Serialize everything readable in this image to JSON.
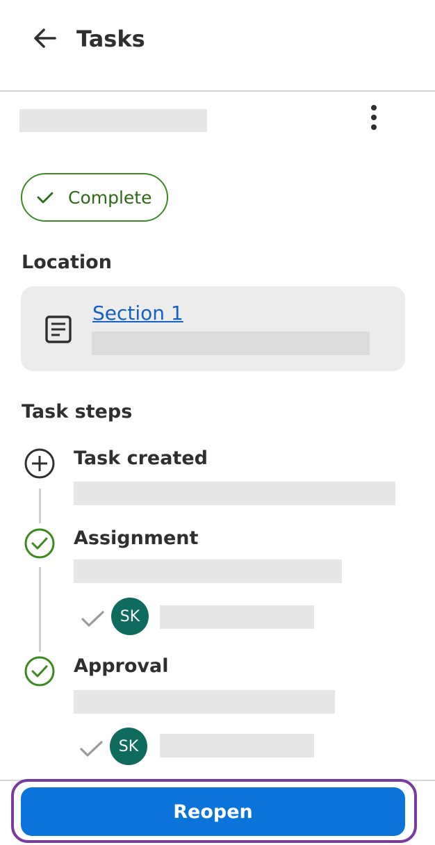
{
  "header": {
    "title": "Tasks",
    "back_icon": "arrow-left-icon"
  },
  "task": {
    "more_icon": "more-vertical-icon",
    "status": {
      "label": "Complete",
      "icon": "check-icon",
      "color": "#3b8a1f"
    }
  },
  "location": {
    "heading": "Location",
    "link_label": "Section 1",
    "icon": "document-icon"
  },
  "steps": {
    "heading": "Task steps",
    "items": [
      {
        "title": "Task created",
        "icon": "plus-circle-icon"
      },
      {
        "title": "Assignment",
        "icon": "check-circle-icon",
        "assignee_initials": "SK"
      },
      {
        "title": "Approval",
        "icon": "check-circle-icon",
        "assignee_initials": "SK"
      }
    ]
  },
  "footer": {
    "reopen_label": "Reopen"
  },
  "colors": {
    "primary": "#0a74da",
    "success": "#3b8a1f",
    "avatar": "#0f6b5e",
    "focus_ring": "#7a3aa0",
    "link": "#1460c4"
  }
}
